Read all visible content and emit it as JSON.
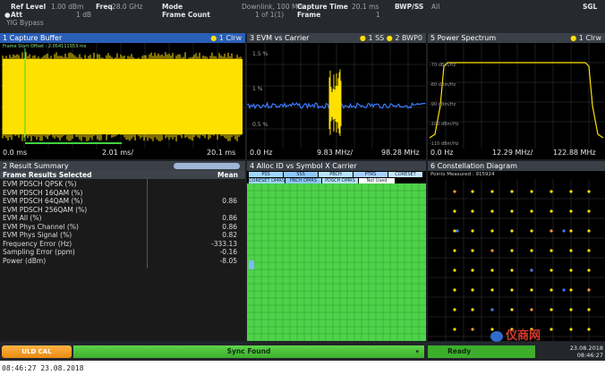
{
  "header": {
    "ref_level_label": "Ref Level",
    "ref_level_value": "1.00 dBm",
    "att_label": "Att",
    "att_value": "1 dB",
    "yig_bypass": "YIG Bypass",
    "freq_label": "Freq",
    "freq_value": "28.0 GHz",
    "mode_label": "Mode",
    "mode_value": "Downlink, 100 MHz",
    "frame_count_label": "Frame Count",
    "frame_count_value": "1 of 1(1)",
    "capture_time_label": "Capture Time",
    "capture_time_value": "20.1 ms",
    "frame_label": "Frame",
    "frame_value": "1",
    "bwp_label": "BWP/SS",
    "bwp_value": "All",
    "sgl": "SGL"
  },
  "windows": {
    "capture_buffer": {
      "title": "1 Capture Buffer",
      "indicator": "1 Clrw",
      "note": "Frame Start Offset : 2.054111553 ms",
      "x_start": "0.0 ms",
      "x_mid": "2.01 ms/",
      "x_end": "20.1 ms"
    },
    "evm_vs_carrier": {
      "title": "3 EVM vs Carrier",
      "indicator_a": "1 SS",
      "indicator_b": "2 BWP0",
      "y_ticks": [
        "1.5 %",
        "1 %",
        "0.5 %"
      ],
      "x_start": "0.0 Hz",
      "x_mid": "9.83 MHz/",
      "x_end": "98.28 MHz"
    },
    "power_spectrum": {
      "title": "5 Power Spectrum",
      "indicator": "1 Clrw",
      "y_ticks": [
        "-70 dBm/Hz",
        "-80 dBm/Hz",
        "-90 dBm/Hz",
        "-100 dBm/Hz",
        "-110 dBm/Hz"
      ],
      "x_start": "0.0 Hz",
      "x_mid": "12.29 MHz/",
      "x_end": "122.88 MHz"
    },
    "result_summary": {
      "title": "2 Result Summary",
      "header_left": "Frame Results Selected",
      "header_right": "Mean",
      "rows": [
        {
          "label": "EVM PDSCH QPSK (%)",
          "value": ""
        },
        {
          "label": "EVM PDSCH 16QAM (%)",
          "value": ""
        },
        {
          "label": "EVM PDSCH 64QAM (%)",
          "value": "0.86"
        },
        {
          "label": "EVM PDSCH 256QAM (%)",
          "value": ""
        },
        {
          "label": "EVM All (%)",
          "value": "0.86"
        },
        {
          "label": "EVM Phys Channel (%)",
          "value": "0.86"
        },
        {
          "label": "EVM Phys Signal (%)",
          "value": "0.82"
        },
        {
          "label": "Frequency Error (Hz)",
          "value": "-333.13"
        },
        {
          "label": "Sampling Error (ppm)",
          "value": "-0.16"
        },
        {
          "label": "Power (dBm)",
          "value": "-8.05"
        }
      ]
    },
    "alloc_id": {
      "title": "4 Alloc ID vs Symbol X Carrier",
      "legend": [
        "PSS",
        "SSS",
        "PBCH",
        "PTRS",
        "CORESET",
        "CORESET DMRS",
        "PBCH DMRS",
        "PDSCH DMRS",
        "Not Used"
      ]
    },
    "constellation": {
      "title": "6 Constellation Diagram",
      "points_measured": "Points Measured : 915924"
    }
  },
  "bottom_bar": {
    "button_label": "ULD CAL",
    "sync_text": "Sync Found",
    "ready_text": "Ready",
    "date": "23.08.2018",
    "time": "08:46:27"
  },
  "watermark": "仪商网",
  "footer_timestamp": "08:46:27  23.08.2018",
  "colors": {
    "accent": "#2a5fb8",
    "trace": "#ffe100",
    "evm_trace": "#3a7bff",
    "alloc": "#4ed24a",
    "sync": "#4bc53a",
    "button": "#f29b1e"
  }
}
